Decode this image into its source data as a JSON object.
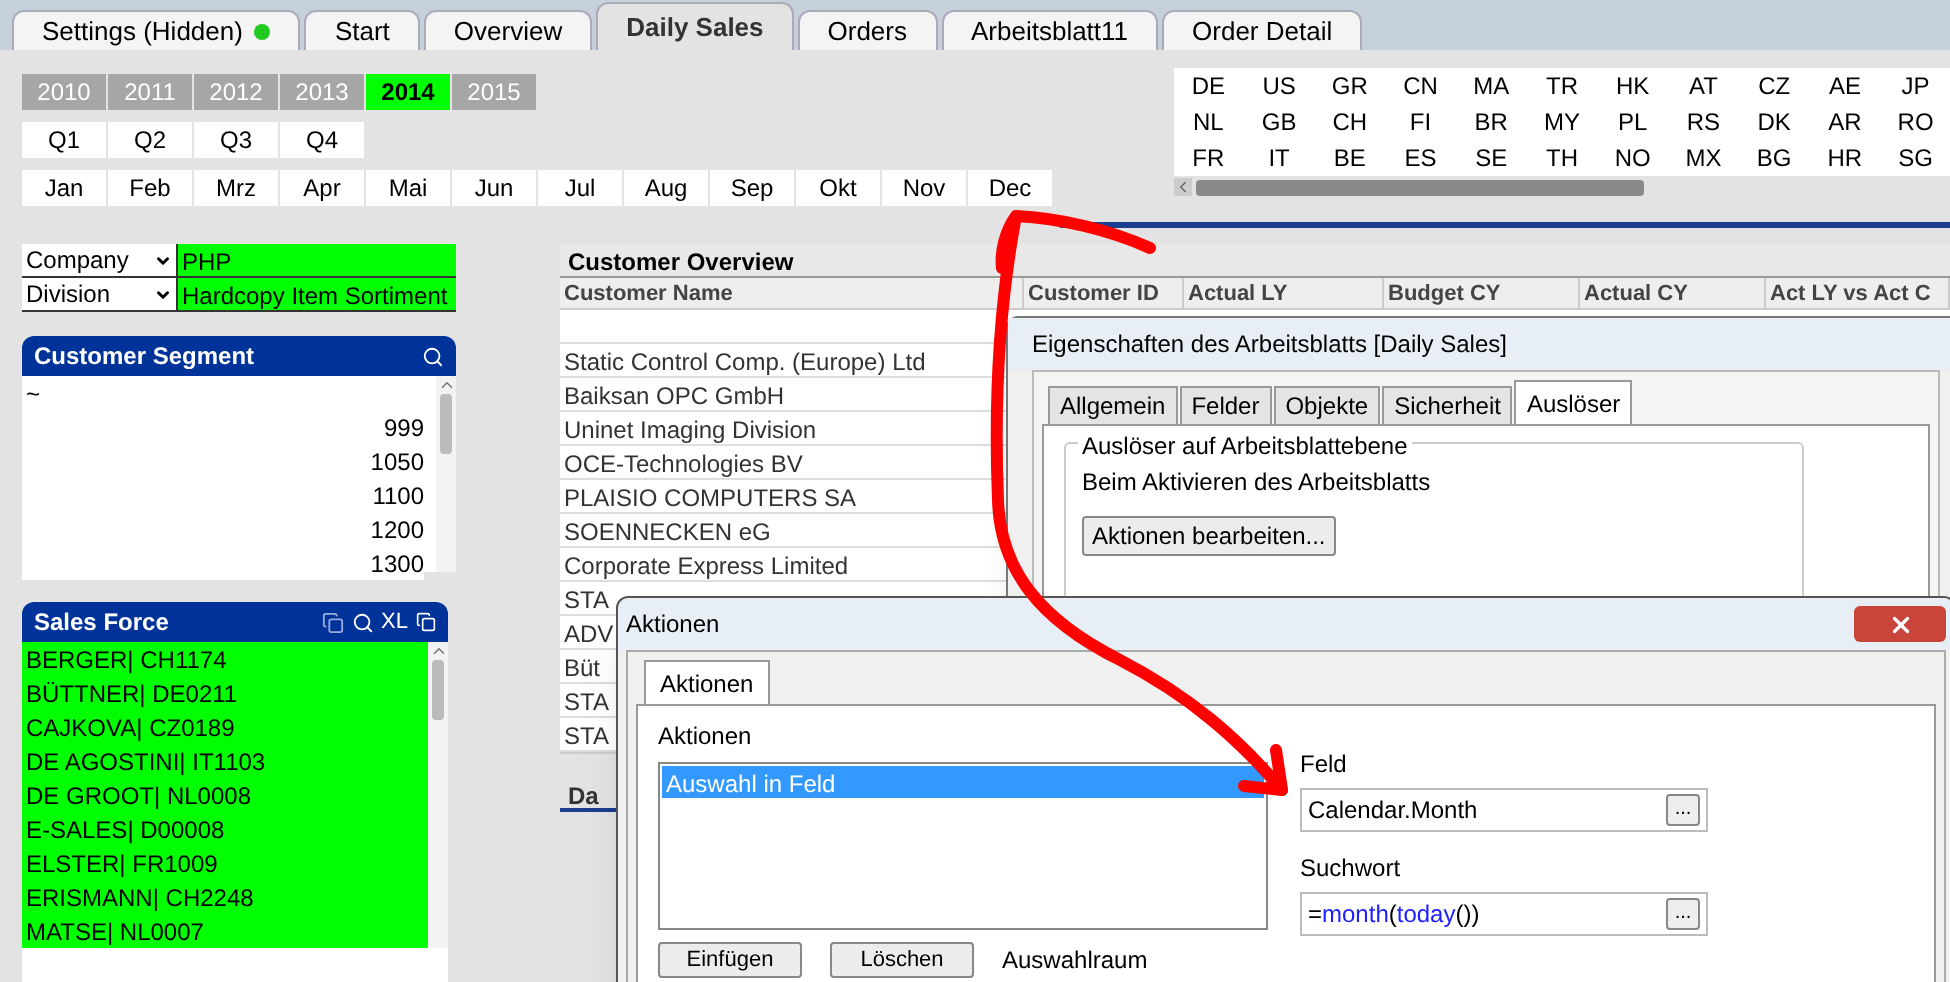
{
  "tabs": [
    {
      "label": "Settings (Hidden)",
      "selected": false,
      "status_dot": true
    },
    {
      "label": "Start",
      "selected": false,
      "status_dot": false
    },
    {
      "label": "Overview",
      "selected": false,
      "status_dot": false
    },
    {
      "label": "Daily Sales",
      "selected": true,
      "status_dot": false
    },
    {
      "label": "Orders",
      "selected": false,
      "status_dot": false
    },
    {
      "label": "Arbeitsblatt11",
      "selected": false,
      "status_dot": false
    },
    {
      "label": "Order Detail",
      "selected": false,
      "status_dot": false
    }
  ],
  "years": [
    {
      "label": "2010",
      "selected": false
    },
    {
      "label": "2011",
      "selected": false
    },
    {
      "label": "2012",
      "selected": false
    },
    {
      "label": "2013",
      "selected": false
    },
    {
      "label": "2014",
      "selected": true
    },
    {
      "label": "2015",
      "selected": false
    }
  ],
  "quarters": [
    "Q1",
    "Q2",
    "Q3",
    "Q4"
  ],
  "months": [
    "Jan",
    "Feb",
    "Mrz",
    "Apr",
    "Mai",
    "Jun",
    "Jul",
    "Aug",
    "Sep",
    "Okt",
    "Nov",
    "Dec"
  ],
  "countries": [
    "DE",
    "US",
    "GR",
    "CN",
    "MA",
    "TR",
    "HK",
    "AT",
    "CZ",
    "AE",
    "JP",
    "NL",
    "GB",
    "CH",
    "FI",
    "BR",
    "MY",
    "PL",
    "RS",
    "DK",
    "AR",
    "RO",
    "FR",
    "IT",
    "BE",
    "ES",
    "SE",
    "TH",
    "NO",
    "MX",
    "BG",
    "HR",
    "SG"
  ],
  "filters": [
    {
      "label": "Company",
      "value": "PHP"
    },
    {
      "label": "Division",
      "value": "Hardcopy Item Sortiment"
    }
  ],
  "customer_segment": {
    "title": "Customer Segment",
    "items": [
      {
        "label": "~",
        "selected": false
      },
      {
        "label": "999",
        "selected": false
      },
      {
        "label": "1050",
        "selected": false
      },
      {
        "label": "1100",
        "selected": false
      },
      {
        "label": "1200",
        "selected": false
      },
      {
        "label": "1300",
        "selected": false
      }
    ]
  },
  "sales_force": {
    "title": "Sales Force",
    "export_label": "XL",
    "items": [
      {
        "label": "BERGER| CH1174",
        "selected": true
      },
      {
        "label": "BÜTTNER| DE0211",
        "selected": true
      },
      {
        "label": "CAJKOVA| CZ0189",
        "selected": true
      },
      {
        "label": "DE AGOSTINI| IT1103",
        "selected": true
      },
      {
        "label": "DE GROOT| NL0008",
        "selected": true
      },
      {
        "label": "E-SALES| D00008",
        "selected": true
      },
      {
        "label": "ELSTER| FR1009",
        "selected": true
      },
      {
        "label": "ERISMANN| CH2248",
        "selected": true
      },
      {
        "label": "MATSE| NL0007",
        "selected": true
      }
    ]
  },
  "customer_overview": {
    "title": "Customer Overview",
    "columns": [
      "Customer Name",
      "Customer ID",
      "Actual LY",
      "Budget CY",
      "Actual CY",
      "Act LY vs Act C"
    ],
    "rows": [
      "",
      "Static Control Comp. (Europe) Ltd",
      "Baiksan OPC GmbH",
      "Uninet Imaging Division",
      "OCE-Technologies BV",
      "PLAISIO COMPUTERS SA",
      "SOENNECKEN eG",
      "Corporate Express Limited",
      "STA",
      "ADV",
      "Büt",
      "STA",
      "STA"
    ]
  },
  "second_panel": {
    "title": "Da"
  },
  "sheet_properties_dialog": {
    "title": "Eigenschaften des Arbeitsblatts [Daily Sales]",
    "tabs": [
      {
        "label": "Allgemein",
        "selected": false
      },
      {
        "label": "Felder",
        "selected": false
      },
      {
        "label": "Objekte",
        "selected": false
      },
      {
        "label": "Sicherheit",
        "selected": false
      },
      {
        "label": "Auslöser",
        "selected": true
      }
    ],
    "group": "Auslöser auf Arbeitsblattebene",
    "event": "Beim Aktivieren des Arbeitsblatts",
    "button": "Aktionen bearbeiten..."
  },
  "actions_dialog": {
    "title": "Aktionen",
    "tab": "Aktionen",
    "list_label": "Aktionen",
    "actions": [
      {
        "label": "Auswahl in Feld",
        "selected": true
      }
    ],
    "field_label": "Feld",
    "field_value": "Calendar.Month",
    "search_label": "Suchwort",
    "search_value": [
      {
        "text": "=",
        "kind": "plain"
      },
      {
        "text": "month",
        "kind": "function"
      },
      {
        "text": "(",
        "kind": "plain"
      },
      {
        "text": "today",
        "kind": "function"
      },
      {
        "text": "())",
        "kind": "plain"
      }
    ],
    "browse": "...",
    "buttons": [
      "Einfügen",
      "Löschen"
    ],
    "scope_label": "Auswahlraum"
  }
}
